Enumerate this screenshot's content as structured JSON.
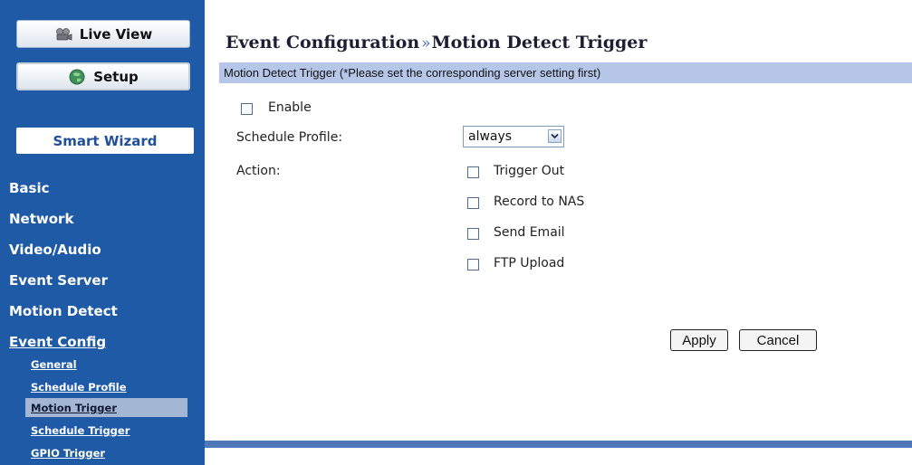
{
  "sidebar": {
    "live_view_label": "Live View",
    "setup_label": "Setup",
    "smart_wizard_label": "Smart Wizard",
    "nav": {
      "basic": "Basic",
      "network": "Network",
      "video_audio": "Video/Audio",
      "event_server": "Event Server",
      "motion_detect": "Motion Detect",
      "event_config": "Event Config"
    },
    "sub_items": {
      "general": "General",
      "schedule_profile": "Schedule Profile",
      "motion_trigger": "Motion Trigger",
      "schedule_trigger": "Schedule Trigger",
      "gpio_trigger": "GPIO Trigger"
    },
    "active_sub_item": "Motion Trigger"
  },
  "main": {
    "title_part1": "Event Configuration",
    "title_separator": "»",
    "title_part2": "Motion Detect Trigger",
    "banner_text": "Motion Detect Trigger  (*Please set the corresponding server setting first)",
    "enable_label": "Enable",
    "schedule_profile_label": "Schedule Profile:",
    "schedule_profile_value": "always",
    "action_label": "Action:",
    "actions": {
      "trigger_out": "Trigger Out",
      "record_to_nas": "Record to NAS",
      "send_email": "Send Email",
      "ftp_upload": "FTP Upload"
    },
    "apply_label": "Apply",
    "cancel_label": "Cancel"
  },
  "colors": {
    "sidebar_bg": "#1f5aa6",
    "banner_bg": "#b5c6e9",
    "active_sub_bg": "#a3b6d4",
    "bottom_bar": "#4f78b8"
  }
}
